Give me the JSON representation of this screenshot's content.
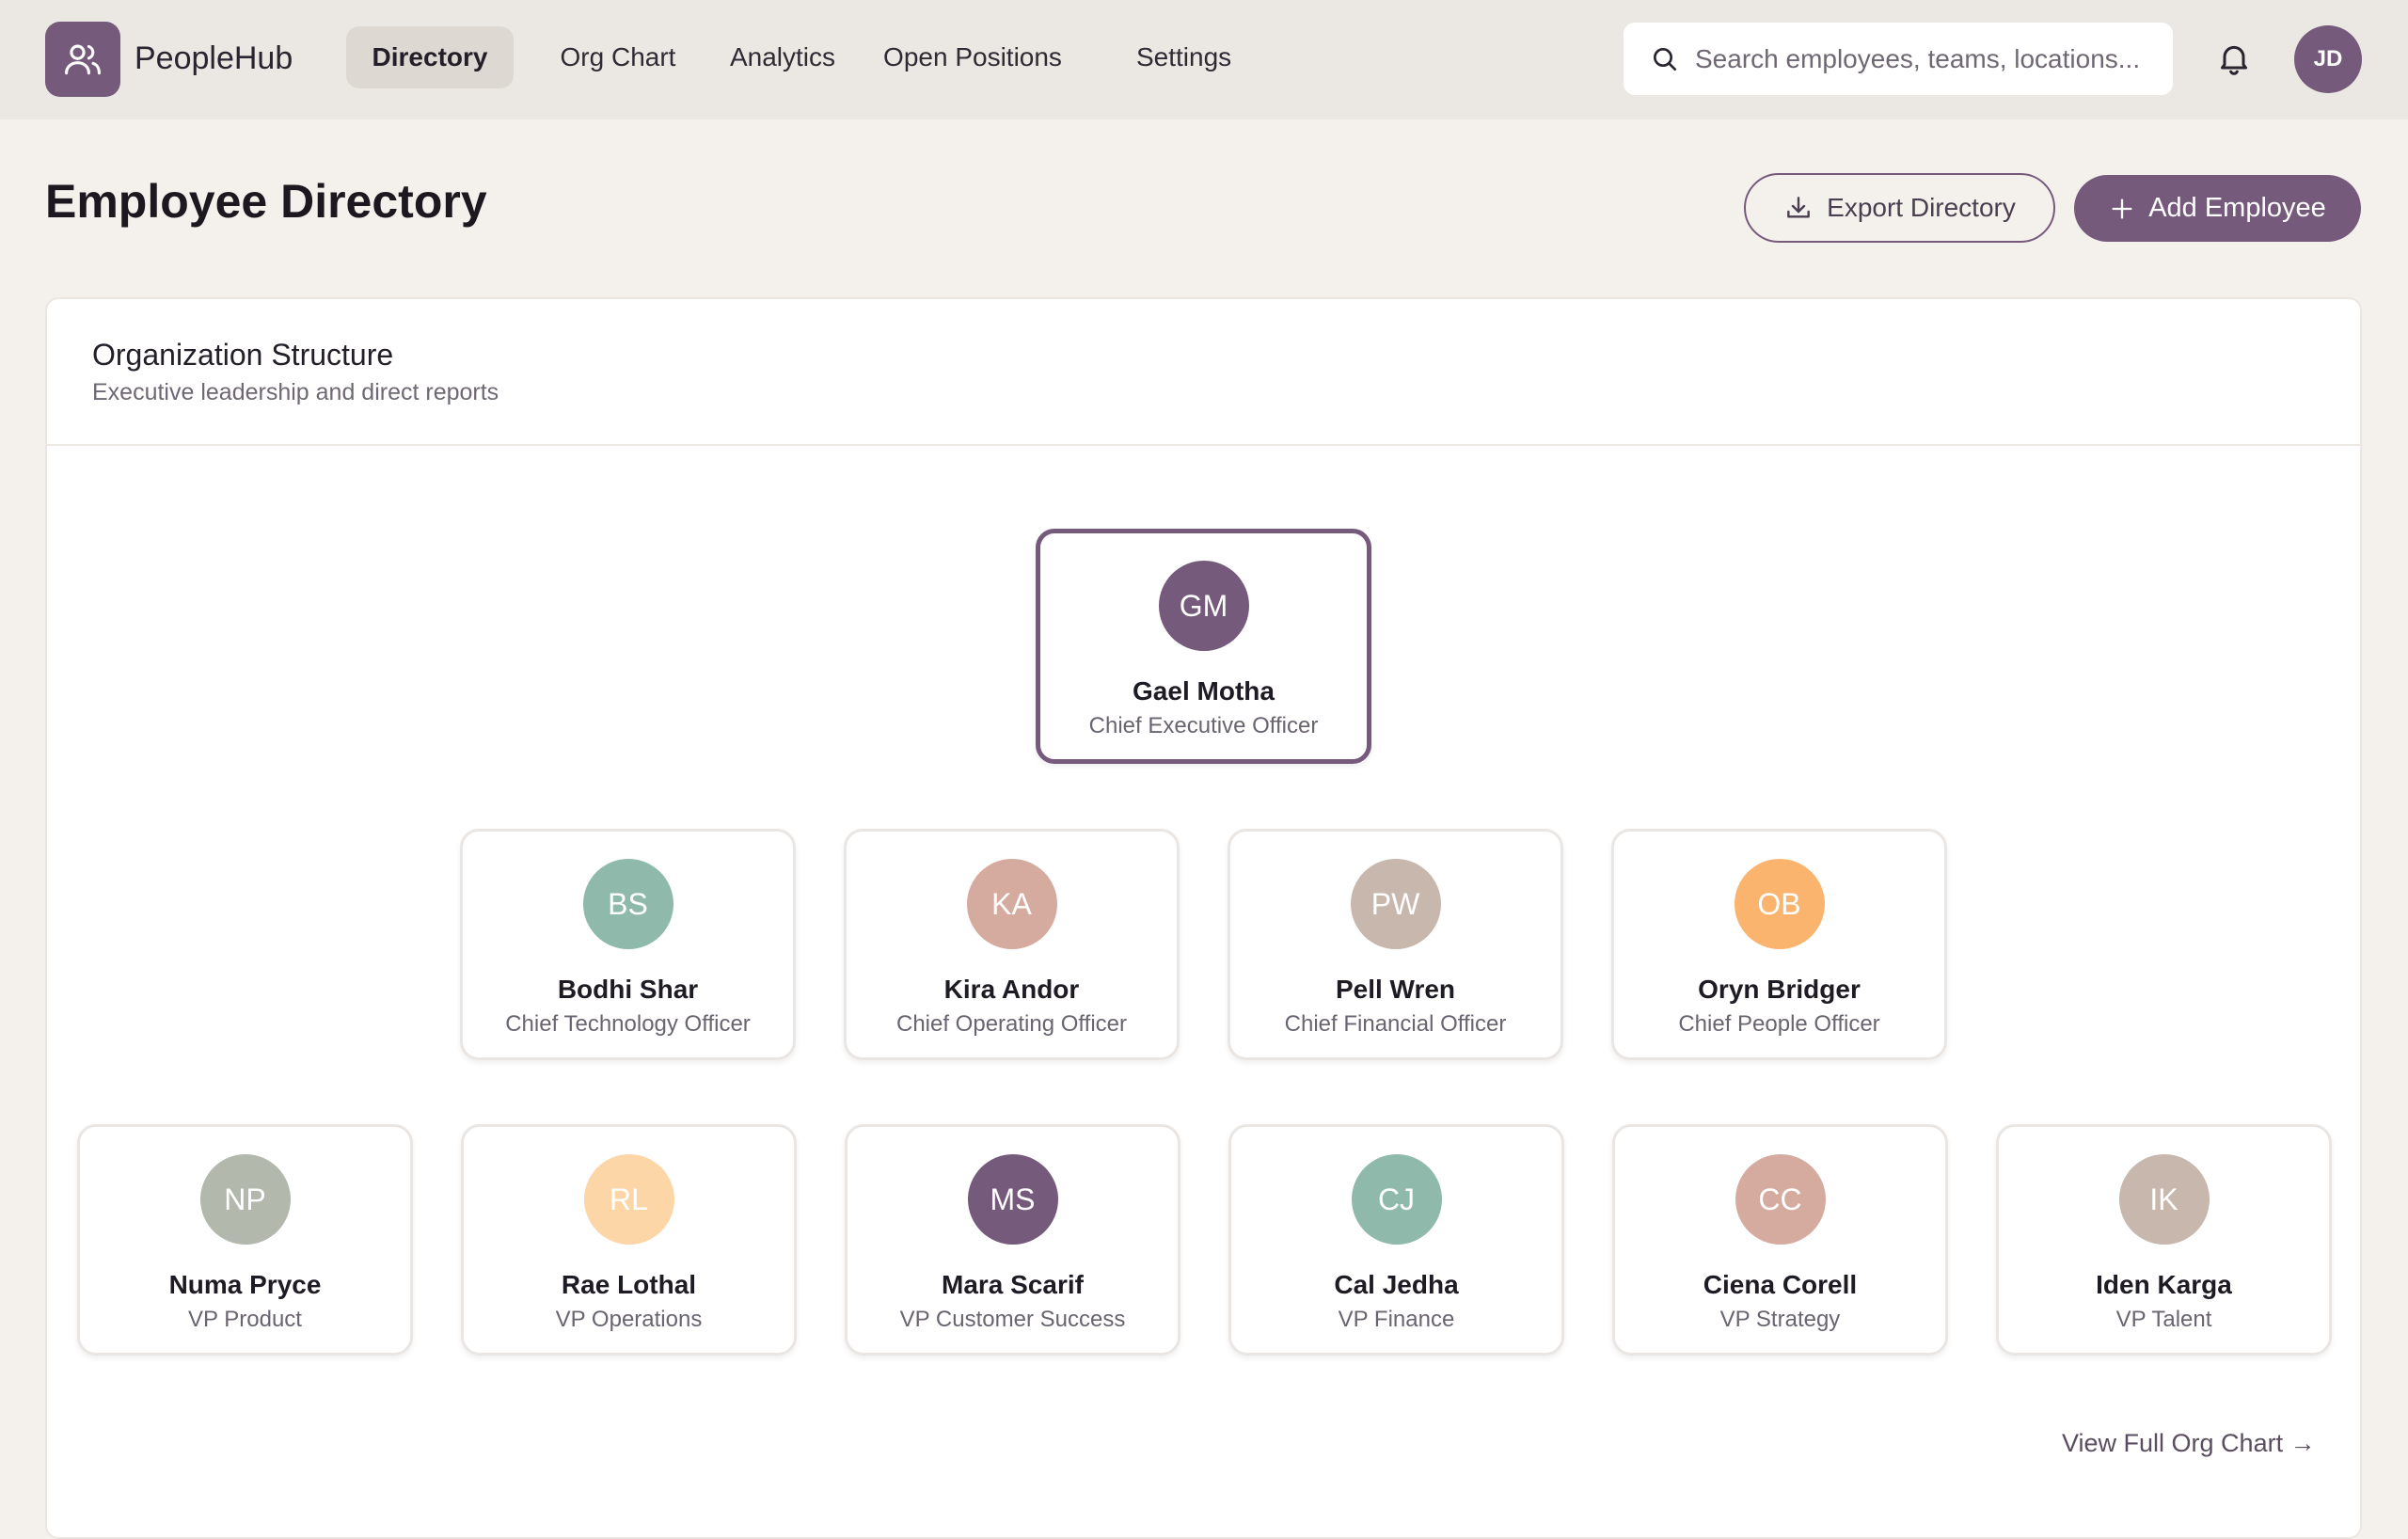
{
  "brand": {
    "name": "PeopleHub"
  },
  "nav": [
    {
      "label": "Directory",
      "active": true
    },
    {
      "label": "Org Chart"
    },
    {
      "label": "Analytics"
    },
    {
      "label": "Open Positions"
    },
    {
      "label": "Settings"
    }
  ],
  "search": {
    "placeholder": "Search employees, teams, locations..."
  },
  "user": {
    "initials": "JD"
  },
  "page": {
    "title": "Employee Directory",
    "export_label": "Export Directory",
    "add_label": "Add Employee"
  },
  "org": {
    "title": "Organization Structure",
    "subtitle": "Executive leadership and direct reports",
    "ceo": {
      "initials": "GM",
      "name": "Gael Motha",
      "role": "Chief Executive Officer",
      "color": "#755a7c"
    },
    "executives": [
      {
        "initials": "BS",
        "name": "Bodhi Shar",
        "role": "Chief Technology Officer",
        "color": "#8fb9ab"
      },
      {
        "initials": "KA",
        "name": "Kira Andor",
        "role": "Chief Operating Officer",
        "color": "#d6ab9f"
      },
      {
        "initials": "PW",
        "name": "Pell Wren",
        "role": "Chief Financial Officer",
        "color": "#c7b7ad"
      },
      {
        "initials": "OB",
        "name": "Oryn Bridger",
        "role": "Chief People Officer",
        "color": "#fab46e"
      }
    ],
    "vps": [
      {
        "initials": "NP",
        "name": "Numa Pryce",
        "role": "VP Product",
        "color": "#b2b8ac"
      },
      {
        "initials": "RL",
        "name": "Rae Lothal",
        "role": "VP Operations",
        "color": "#fdd6a8"
      },
      {
        "initials": "MS",
        "name": "Mara Scarif",
        "role": "VP Customer Success",
        "color": "#755a7c"
      },
      {
        "initials": "CJ",
        "name": "Cal Jedha",
        "role": "VP Finance",
        "color": "#8fb9ab"
      },
      {
        "initials": "CC",
        "name": "Ciena Corell",
        "role": "VP Strategy",
        "color": "#d6ab9f"
      },
      {
        "initials": "IK",
        "name": "Iden Karga",
        "role": "VP Talent",
        "color": "#c7b7ad"
      }
    ],
    "view_full_label": "View Full Org Chart →"
  }
}
